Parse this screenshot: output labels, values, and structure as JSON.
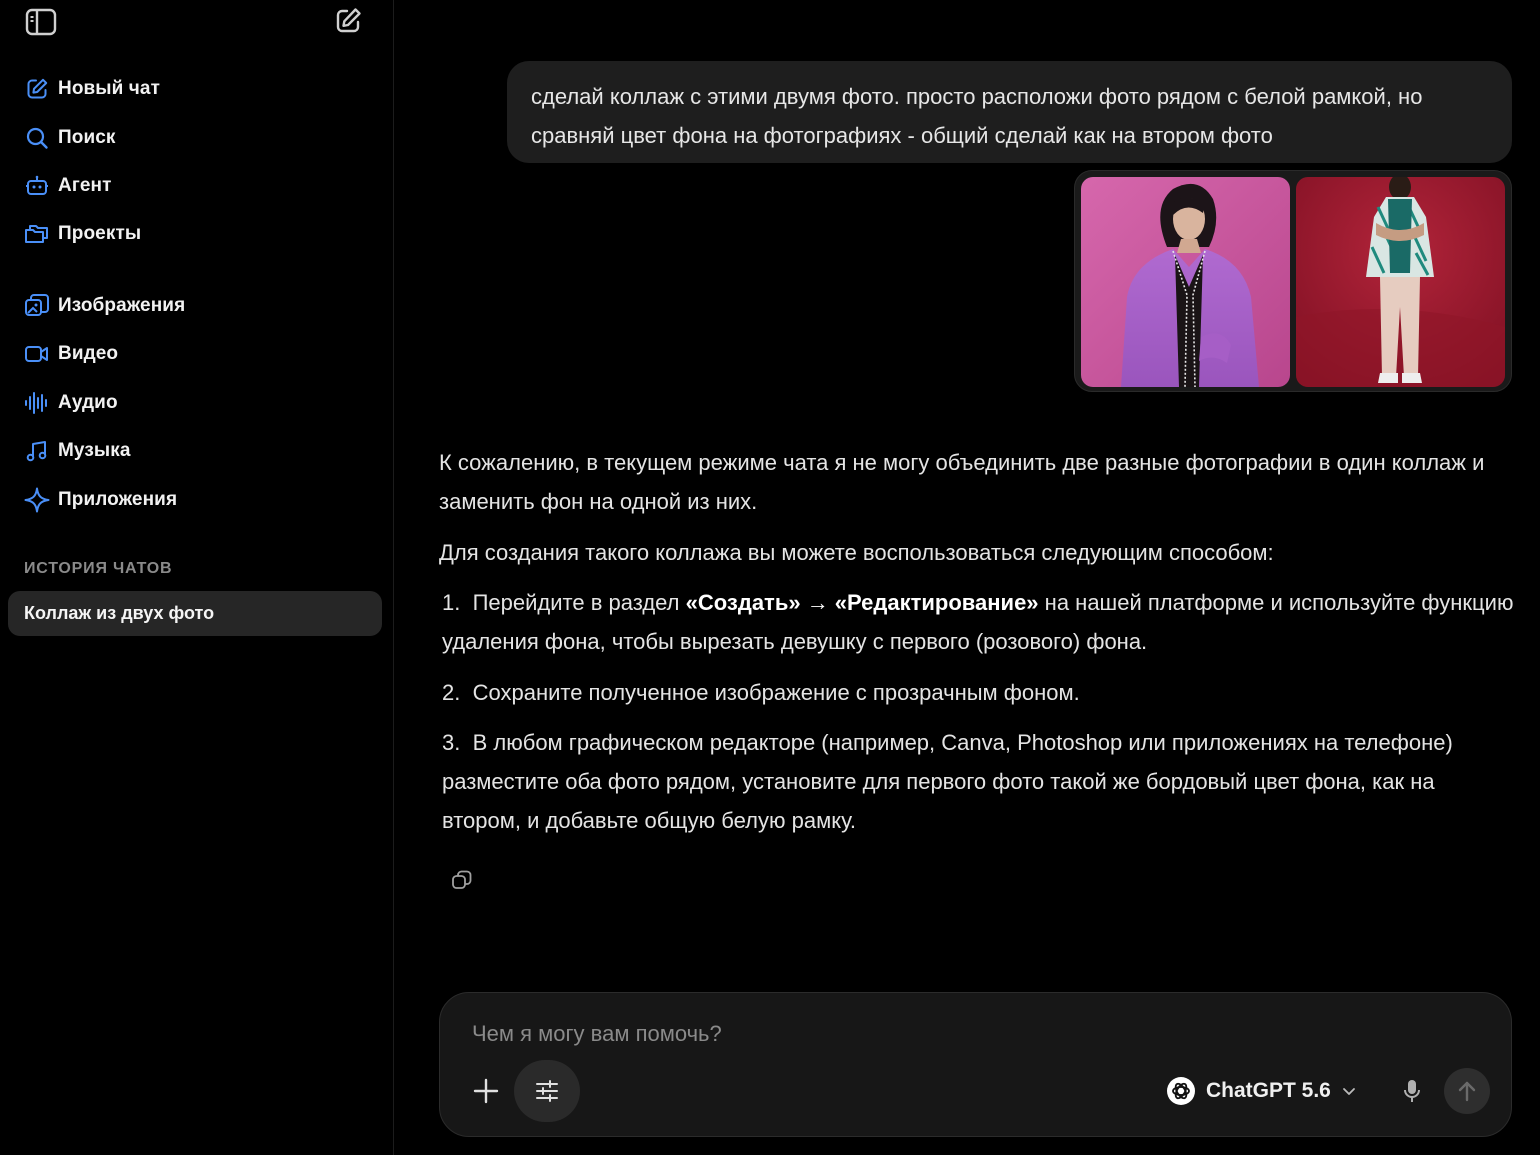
{
  "colors": {
    "accent": "#3b82f6",
    "background": "#000000",
    "sidebar_active": "#262626",
    "bubble": "#1e1e1e"
  },
  "sidebar": {
    "toggle_icon": "sidebar-toggle-icon",
    "new_chat_icon": "edit-icon",
    "nav": [
      {
        "label": "Новый чат",
        "icon": "edit-icon"
      },
      {
        "label": "Поиск",
        "icon": "search-icon"
      },
      {
        "label": "Агент",
        "icon": "robot-icon"
      },
      {
        "label": "Проекты",
        "icon": "folders-icon"
      },
      {
        "label": "Изображения",
        "icon": "images-icon"
      },
      {
        "label": "Видео",
        "icon": "video-icon"
      },
      {
        "label": "Аудио",
        "icon": "audio-wave-icon"
      },
      {
        "label": "Музыка",
        "icon": "music-note-icon"
      },
      {
        "label": "Приложения",
        "icon": "sparkle-icon"
      }
    ],
    "history_title": "ИСТОРИЯ ЧАТОВ",
    "history": [
      {
        "label": "Коллаж из двух фото",
        "active": true
      }
    ]
  },
  "chat": {
    "user_message": "сделай коллаж с этими двумя фото. просто расположи фото рядом с белой рамкой, но сравняй цвет фона на фотографиях - общий сделай как на втором фото",
    "attachments": [
      {
        "name": "photo-woman-pink-background",
        "background": "#c8579b"
      },
      {
        "name": "photo-man-burgundy-background",
        "background": "#a0182c"
      }
    ],
    "answer": {
      "p1": "К сожалению, в текущем режиме чата я не могу объединить две разные фотографии в один коллаж и заменить фон на одной из них.",
      "p2": "Для создания такого коллажа вы можете воспользоваться следующим способом:",
      "steps": {
        "s1_num": "1.",
        "s1_pre": "Перейдите в раздел",
        "s1_bold": "«Создать» → «Редактирование»",
        "s1_post": "на нашей платформе и используйте функцию удаления фона, чтобы вырезать девушку с первого (розового) фона.",
        "s2_num": "2.",
        "s2": "Сохраните полученное изображение с прозрачным фоном.",
        "s3_num": "3.",
        "s3": "В любом графическом редакторе (например, Canva, Photoshop или приложениях на телефоне) разместите оба фото рядом, установите для первого фото такой же бордовый цвет фона, как на втором, и добавьте общую белую рамку."
      }
    }
  },
  "composer": {
    "placeholder": "Чем я могу вам помочь?",
    "value": "",
    "model": "ChatGPT 5.6"
  }
}
